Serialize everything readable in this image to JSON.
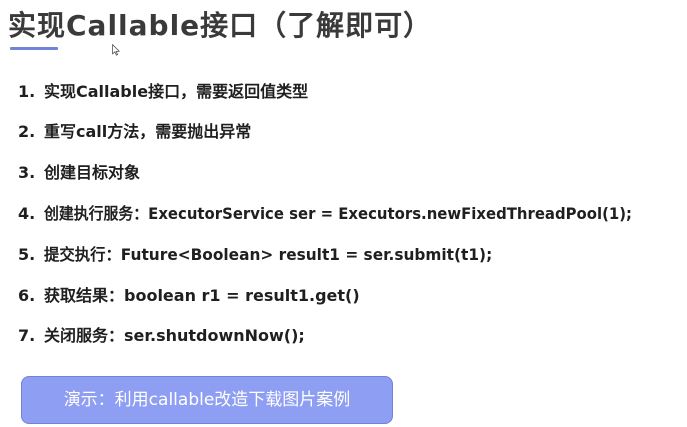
{
  "title": "实现Callable接口（了解即可）",
  "items": [
    {
      "num": "1.",
      "text": "实现Callable接口，需要返回值类型"
    },
    {
      "num": "2.",
      "text": "重写call方法，需要抛出异常"
    },
    {
      "num": "3.",
      "text": "创建目标对象"
    },
    {
      "num": "4.",
      "text": "创建执行服务：ExecutorService ser = Executors.newFixedThreadPool(1);"
    },
    {
      "num": "5.",
      "text": "提交执行：Future<Boolean> result1 = ser.submit(t1);"
    },
    {
      "num": "6.",
      "text": "获取结果：boolean r1 = result1.get()"
    },
    {
      "num": "7.",
      "text": "关闭服务：ser.shutdownNow();"
    }
  ],
  "demo_button": {
    "label": "演示：利用callable改造下载图片案例"
  },
  "colors": {
    "accent": "#6f83d8",
    "button_bg": "#8e9ef3",
    "title_text": "#3a3a3a"
  },
  "icons": {
    "cursor": "mouse-pointer-icon"
  }
}
